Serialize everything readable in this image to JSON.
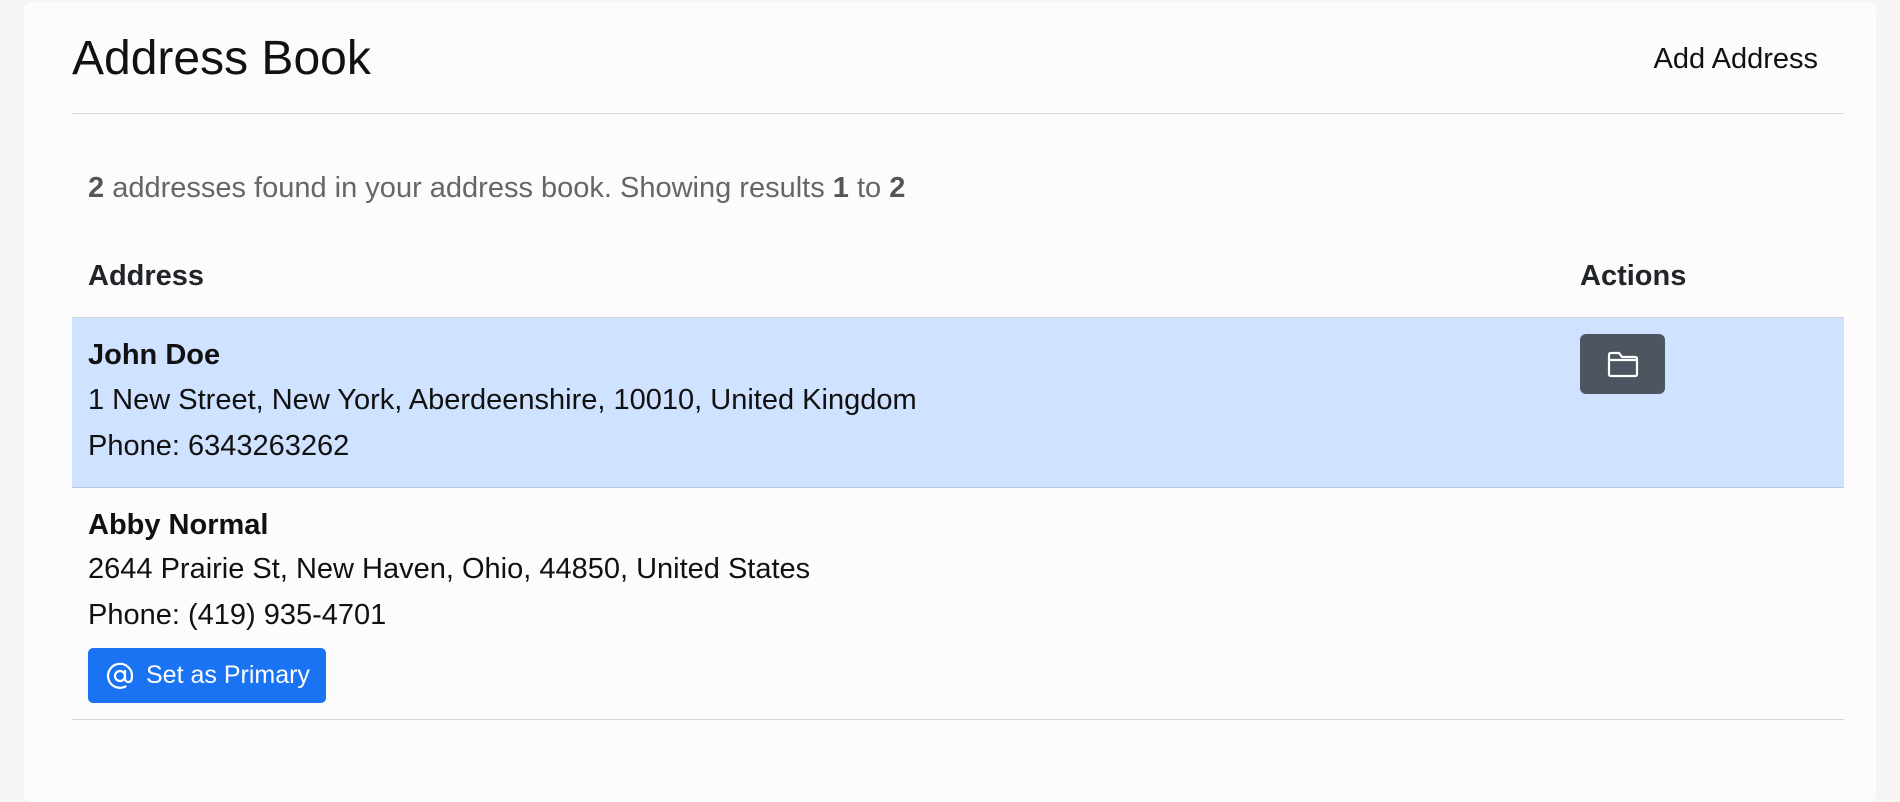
{
  "header": {
    "title": "Address Book",
    "add_label": "Add Address"
  },
  "summary": {
    "count": "2",
    "text_mid": " addresses found in your address book. Showing results ",
    "from": "1",
    "to_word": " to ",
    "to": "2"
  },
  "table": {
    "columns": [
      "Address",
      "Actions"
    ],
    "rows": [
      {
        "name": "John Doe",
        "address": "1 New Street, New York, Aberdeenshire, 10010, United Kingdom",
        "phone": "Phone: 6343263262",
        "highlighted": true,
        "action_icon": "folder-icon"
      },
      {
        "name": "Abby Normal",
        "address": "2644 Prairie St, New Haven, Ohio, 44850, United States",
        "phone": "Phone: (419) 935-4701",
        "button_label": "Set as Primary",
        "button_icon": "at-sign-icon"
      }
    ]
  },
  "colors": {
    "highlight_row": "#cfe2ff",
    "primary_button": "#1a73f2",
    "secondary_button": "#4d5560"
  }
}
